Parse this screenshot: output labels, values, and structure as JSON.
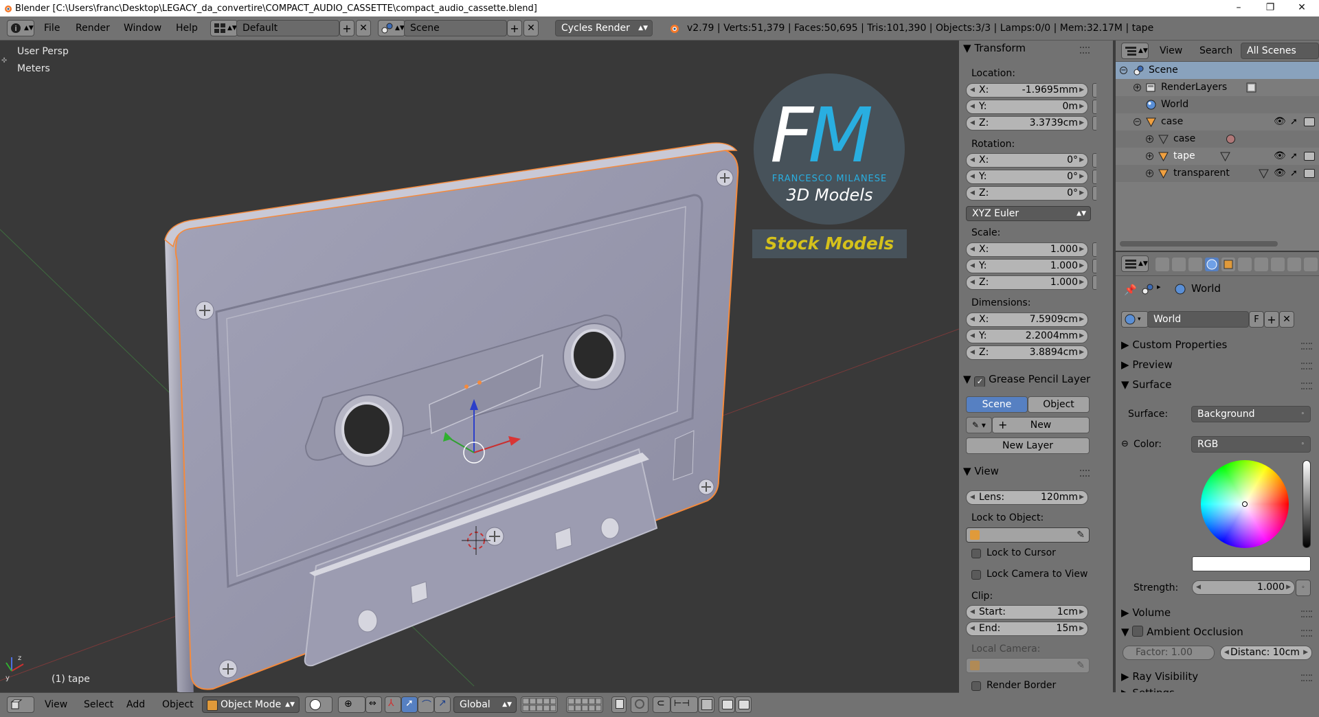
{
  "window": {
    "title": "Blender [C:\\Users\\franc\\Desktop\\LEGACY_da_convertire\\COMPACT_AUDIO_CASSETTE\\compact_audio_cassette.blend]",
    "controls": [
      "–",
      "❐",
      "✕"
    ]
  },
  "info_header": {
    "menus": [
      "File",
      "Render",
      "Window",
      "Help"
    ],
    "screen_layout": "Default",
    "scene": "Scene",
    "render_engine": "Cycles Render",
    "stats": "v2.79 | Verts:51,379 | Faces:50,695 | Tris:101,390 | Objects:3/3 | Lamps:0/0 | Mem:32.17M | tape"
  },
  "viewport": {
    "view_name": "User Persp",
    "units": "Meters",
    "active_object": "(1) tape",
    "watermark": {
      "letters": "FM",
      "name": "FRANCESCO MILANESE",
      "subtitle": "3D Models",
      "tagline": "Stock Models"
    }
  },
  "transform": {
    "header": "Transform",
    "location_label": "Location:",
    "location": [
      {
        "axis": "X:",
        "value": "-1.9695mm"
      },
      {
        "axis": "Y:",
        "value": "0m"
      },
      {
        "axis": "Z:",
        "value": "3.3739cm"
      }
    ],
    "rotation_label": "Rotation:",
    "rotation": [
      {
        "axis": "X:",
        "value": "0°"
      },
      {
        "axis": "Y:",
        "value": "0°"
      },
      {
        "axis": "Z:",
        "value": "0°"
      }
    ],
    "rotation_mode": "XYZ Euler",
    "scale_label": "Scale:",
    "scale": [
      {
        "axis": "X:",
        "value": "1.000"
      },
      {
        "axis": "Y:",
        "value": "1.000"
      },
      {
        "axis": "Z:",
        "value": "1.000"
      }
    ],
    "dimensions_label": "Dimensions:",
    "dimensions": [
      {
        "axis": "X:",
        "value": "7.5909cm"
      },
      {
        "axis": "Y:",
        "value": "2.2004mm"
      },
      {
        "axis": "Z:",
        "value": "3.8894cm"
      }
    ]
  },
  "grease_pencil": {
    "header": "Grease Pencil Layer",
    "tab_scene": "Scene",
    "tab_object": "Object",
    "new": "New",
    "new_layer": "New Layer"
  },
  "view_panel": {
    "header": "View",
    "lens_label": "Lens:",
    "lens_value": "120mm",
    "lock_to_object": "Lock to Object:",
    "lock_to_cursor": "Lock to Cursor",
    "lock_camera": "Lock Camera to View",
    "clip_label": "Clip:",
    "clip_start_label": "Start:",
    "clip_start": "1cm",
    "clip_end_label": "End:",
    "clip_end": "15m",
    "local_camera": "Local Camera:",
    "render_border": "Render Border"
  },
  "outliner": {
    "menus": [
      "View",
      "Search"
    ],
    "filter": "All Scenes",
    "rows": [
      {
        "label": "Scene"
      },
      {
        "label": "RenderLayers"
      },
      {
        "label": "World"
      },
      {
        "label": "case"
      },
      {
        "label": "case"
      },
      {
        "label": "tape"
      },
      {
        "label": "transparent"
      }
    ]
  },
  "properties": {
    "context": "World",
    "world_name": "World",
    "world_fake": "F",
    "sections": {
      "custom_properties": "Custom Properties",
      "preview": "Preview",
      "surface": "Surface",
      "volume": "Volume",
      "ambient_occlusion": "Ambient Occlusion",
      "ray_visibility": "Ray Visibility",
      "settings": "Settings"
    },
    "surface_label": "Surface:",
    "surface_value": "Background",
    "color_label": "Color:",
    "color_mode": "RGB",
    "strength_label": "Strength:",
    "strength_value": "1.000",
    "factor": "Factor:     1.00",
    "distance": "Distanc:  10cm"
  },
  "bottom_header": {
    "menus": [
      "View",
      "Select",
      "Add",
      "Object"
    ],
    "mode": "Object Mode",
    "orientation": "Global"
  },
  "colors": {
    "accent_selection": "#5680c2",
    "viewport_bg": "#393939",
    "object_outline": "#f58a3c",
    "mesh_color": "#9a9aaf",
    "fm_blue": "#29aee0",
    "stock_yellow": "#d5c11b"
  }
}
